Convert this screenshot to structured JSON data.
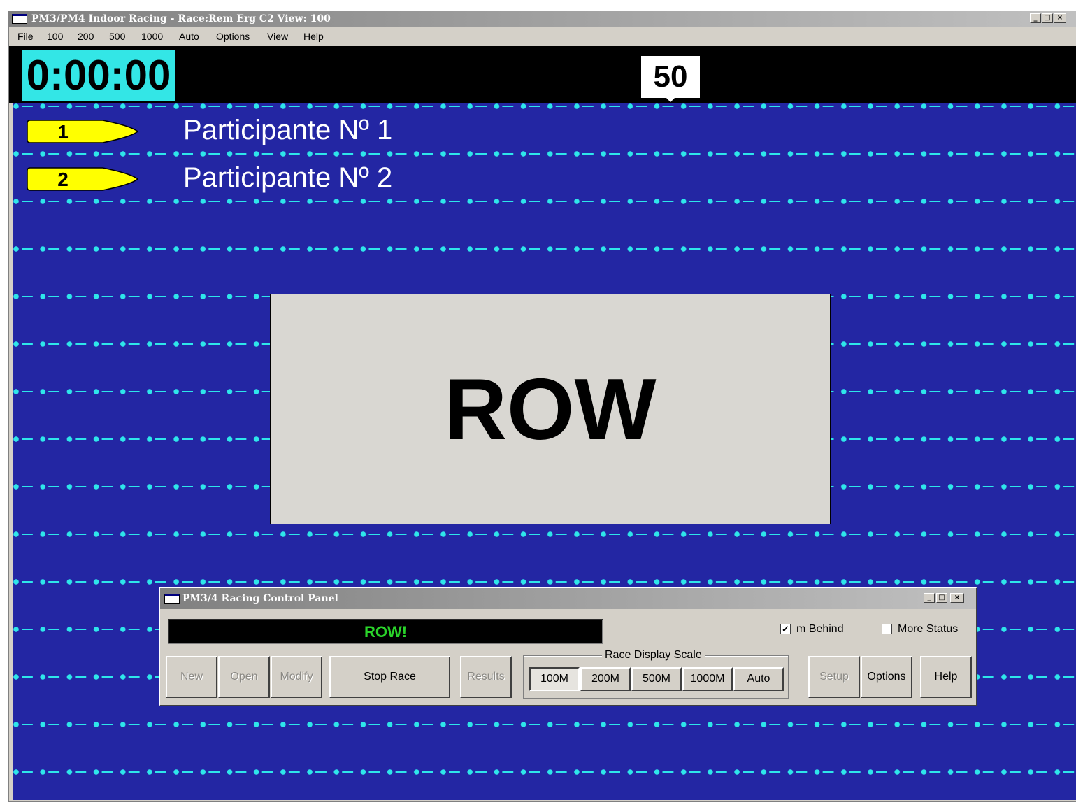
{
  "window": {
    "title": "PM3/PM4 Indoor Racing - Race:Rem Erg C2  View: 100",
    "controls": {
      "minimize": "_",
      "maximize": "□",
      "close": "×"
    }
  },
  "menu": [
    {
      "label": "File",
      "mnemonic": "F"
    },
    {
      "label": "100",
      "mnemonic": "1"
    },
    {
      "label": "200",
      "mnemonic": "2"
    },
    {
      "label": "500",
      "mnemonic": "5"
    },
    {
      "label": "1000",
      "mnemonic": "0"
    },
    {
      "label": "Auto",
      "mnemonic": "A"
    },
    {
      "label": "Options",
      "mnemonic": "O"
    },
    {
      "label": "View",
      "mnemonic": "V"
    },
    {
      "label": "Help",
      "mnemonic": "H"
    }
  ],
  "race": {
    "timer": "0:00:00",
    "distance_marker": "50",
    "lanes": [
      {
        "number": "1",
        "name": "Participante Nº 1"
      },
      {
        "number": "2",
        "name": "Participante Nº 2"
      }
    ],
    "center_message": "ROW"
  },
  "control_panel": {
    "title": "PM3/4 Racing Control Panel",
    "status": "ROW!",
    "checkboxes": {
      "m_behind": {
        "label": "m Behind",
        "checked": true
      },
      "more_status": {
        "label": "More Status",
        "checked": false
      }
    },
    "buttons": {
      "new": "New",
      "open": "Open",
      "modify": "Modify",
      "stop_race": "Stop Race",
      "results": "Results",
      "setup": "Setup",
      "options": "Options",
      "help": "Help"
    },
    "scale": {
      "legend": "Race Display Scale",
      "options": [
        "100M",
        "200M",
        "500M",
        "1000M",
        "Auto"
      ],
      "selected": "100M"
    }
  },
  "colors": {
    "water": "#2326a3",
    "lane_line": "#2ee6ea",
    "timer_bg": "#33e6e6",
    "boat": "#ffff00",
    "status_text": "#2ad42a"
  },
  "icons": {
    "checkmark": "✓"
  }
}
